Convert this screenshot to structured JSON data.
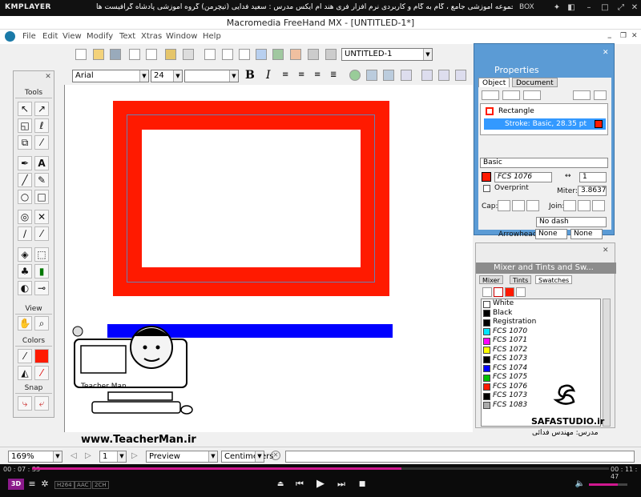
{
  "player": {
    "logo": "KMPLAYER",
    "title": "مجموعه آموزشی جامع ، گام به گام و کاربردی نرم افزار فری هند ام ایکس  مدرس : سعید فدایی (تیچرمن) گروه آموزشی پادشاه گرافیست ها",
    "box_label": "BOX",
    "time_current": "00 : 07 : 33",
    "time_total": "00 : 11 : 47",
    "progress": 0.64,
    "volume": 0.75,
    "badges": [
      "H264",
      "AAC",
      "2CH"
    ],
    "mode_3d": "3D"
  },
  "window": {
    "title": "Macromedia FreeHand MX - [UNTITLED-1*]"
  },
  "menu": [
    "File",
    "Edit",
    "View",
    "Modify",
    "Text",
    "Xtras",
    "Window",
    "Help"
  ],
  "toolbar": {
    "document_select": "UNTITLED-1",
    "font_family": "Arial",
    "font_size": "24",
    "bold_label": "B",
    "italic_label": "I"
  },
  "tools_panel": {
    "sections": [
      "Tools",
      "View",
      "Colors",
      "Snap"
    ]
  },
  "properties": {
    "title": "Properties",
    "tabs": [
      "Object",
      "Document"
    ],
    "object_name": "Rectangle",
    "stroke_row": "Stroke: Basic, 28.35 pt",
    "stroke_type": "Basic",
    "color_name": "FCS 1076",
    "width_value": "1",
    "overprint_label": "Overprint",
    "miter_label": "Miter:",
    "miter_value": "3.8637",
    "cap_label": "Cap:",
    "join_label": "Join:",
    "dash": "No dash",
    "arrowheads_label": "Arrowheads:",
    "arrow_start": "None",
    "arrow_end": "None",
    "accent": "#5b9bd5",
    "stroke_color": "#ff1a00"
  },
  "swatches_panel": {
    "title": "Mixer and Tints and Sw...",
    "tabs": [
      "Mixer",
      "Tints",
      "Swatches"
    ],
    "items": [
      {
        "name": "White",
        "color": "#ffffff",
        "italic": false
      },
      {
        "name": "Black",
        "color": "#000000",
        "italic": false
      },
      {
        "name": "Registration",
        "color": "#000000",
        "italic": false
      },
      {
        "name": "FCS 1070",
        "color": "#00e5ff",
        "italic": true
      },
      {
        "name": "FCS 1071",
        "color": "#ff00ff",
        "italic": true
      },
      {
        "name": "FCS 1072",
        "color": "#ffff00",
        "italic": true
      },
      {
        "name": "FCS 1073",
        "color": "#000000",
        "italic": true
      },
      {
        "name": "FCS 1074",
        "color": "#0000ff",
        "italic": true
      },
      {
        "name": "FCS 1075",
        "color": "#00c000",
        "italic": true
      },
      {
        "name": "FCS 1076",
        "color": "#ff1a00",
        "italic": true
      },
      {
        "name": "FCS 1073",
        "color": "#000000",
        "italic": true
      },
      {
        "name": "FCS 1083",
        "color": "#aaaaaa",
        "italic": true
      }
    ]
  },
  "watermark": {
    "url": "www.TeacherMan.ir",
    "label": "Teacher Man",
    "studio": "SAFASTUDIO.ir",
    "teacher": "مدرس: مهندس فدائی"
  },
  "status": {
    "zoom": "169%",
    "page": "1",
    "view_mode": "Preview",
    "units": "Centimeters"
  }
}
